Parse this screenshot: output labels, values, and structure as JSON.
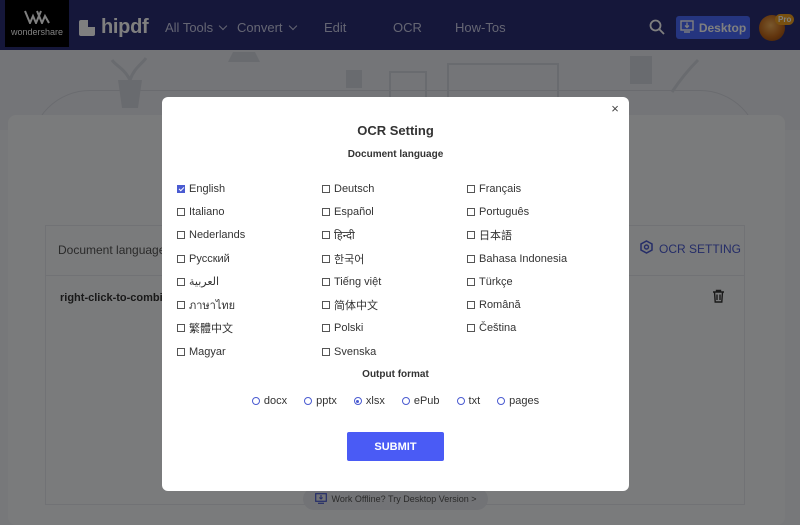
{
  "navbar": {
    "logo_text": "wondershare",
    "brand": "hipdf",
    "items": [
      {
        "label": "All Tools",
        "has_dropdown": true
      },
      {
        "label": "Convert",
        "has_dropdown": true
      },
      {
        "label": "Edit",
        "has_dropdown": false
      },
      {
        "label": "OCR",
        "has_dropdown": false
      },
      {
        "label": "How-Tos",
        "has_dropdown": false
      }
    ],
    "desktop_label": "Desktop",
    "pro_badge": "Pro",
    "background": "#2b2f74",
    "accent": "#4a6bff"
  },
  "page": {
    "doc_lang_label": "Document language",
    "ocr_setting_label": "OCR SETTING",
    "file_name": "right-click-to-combine",
    "offline_text": "Work Offline? Try Desktop Version >"
  },
  "modal": {
    "title": "OCR Setting",
    "close_symbol": "×",
    "language_section": "Document language",
    "languages": [
      {
        "label": "English",
        "checked": true
      },
      {
        "label": "Deutsch",
        "checked": false
      },
      {
        "label": "Français",
        "checked": false
      },
      {
        "label": "Italiano",
        "checked": false
      },
      {
        "label": "Español",
        "checked": false
      },
      {
        "label": "Português",
        "checked": false
      },
      {
        "label": "Nederlands",
        "checked": false
      },
      {
        "label": "हिन्दी",
        "checked": false
      },
      {
        "label": "日本語",
        "checked": false
      },
      {
        "label": "Русский",
        "checked": false
      },
      {
        "label": "한국어",
        "checked": false
      },
      {
        "label": "Bahasa Indonesia",
        "checked": false
      },
      {
        "label": "العربية",
        "checked": false
      },
      {
        "label": "Tiếng việt",
        "checked": false
      },
      {
        "label": "Türkçe",
        "checked": false
      },
      {
        "label": "ภาษาไทย",
        "checked": false
      },
      {
        "label": "简体中文",
        "checked": false
      },
      {
        "label": "Română",
        "checked": false
      },
      {
        "label": "繁體中文",
        "checked": false
      },
      {
        "label": "Polski",
        "checked": false
      },
      {
        "label": "Čeština",
        "checked": false
      },
      {
        "label": "Magyar",
        "checked": false
      },
      {
        "label": "Svenska",
        "checked": false
      }
    ],
    "format_section": "Output format",
    "formats": [
      {
        "label": "docx",
        "checked": false
      },
      {
        "label": "pptx",
        "checked": false
      },
      {
        "label": "xlsx",
        "checked": true
      },
      {
        "label": "ePub",
        "checked": false
      },
      {
        "label": "txt",
        "checked": false
      },
      {
        "label": "pages",
        "checked": false
      }
    ],
    "submit_label": "SUBMIT",
    "accent": "#4a5bf5"
  }
}
